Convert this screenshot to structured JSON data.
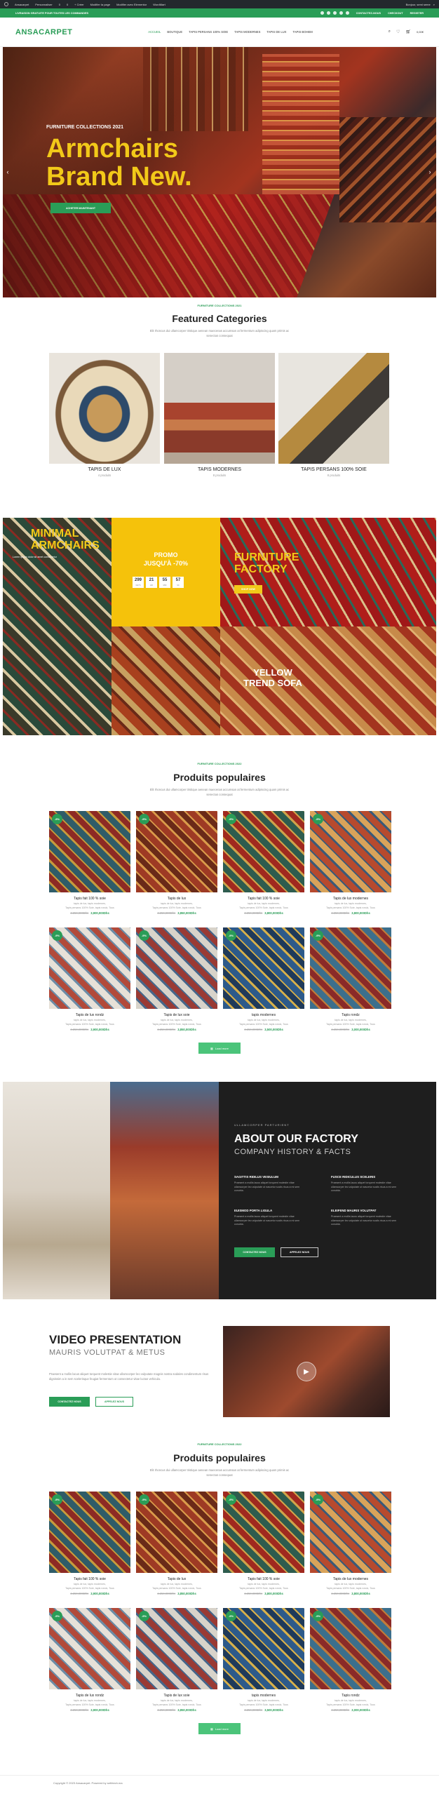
{
  "adminbar": {
    "items": [
      "Ansacarpet",
      "Personnaliser",
      "0",
      "0",
      "+ Créer",
      "Modifier la page",
      "Modifier avec Elementor",
      "WordMart"
    ],
    "right": "Bonjour, semi seme"
  },
  "topbar": {
    "text": "LIVRAISON GRATUITE POUR TOUTES LES COMMANDES",
    "links": [
      "CONTACTEZ-NOUS",
      "CHECKOUT",
      "REGISTER"
    ]
  },
  "header": {
    "logo": "ANSACARPET",
    "nav": [
      "ACCUEIL",
      "BOUTIQUE",
      "TAPIS PERSANS 100% SOIE",
      "TAPIS MODERNES",
      "TAPIS DE LUX",
      "TAPIS BOHEM"
    ],
    "cart": "0,00€"
  },
  "hero": {
    "subtitle": "FURNITURE COLLECTIONS 2021",
    "title_line1": "Armchairs",
    "title_line2": "Brand New.",
    "button": "ACHETER MAINTENANT"
  },
  "featured": {
    "kicker": "FURNITURE COLLECTIONS 2021",
    "title": "Featured Categories",
    "desc": "Elit rhoncus dui ullamcorper tristique aenean maecenas accumsan at fermentum adipiscing quam primis ac senectus consequat",
    "categories": [
      {
        "name": "TAPIS DE LUX",
        "count": "4 produits",
        "colors": [
          "#e9d9b9",
          "#2d4a6a",
          "#c79a5a"
        ]
      },
      {
        "name": "TAPIS MODERNES",
        "count": "8 produits",
        "colors": [
          "#d5cfc7",
          "#a8432e",
          "#6d7c8a"
        ]
      },
      {
        "name": "TAPIS PERSANS 100% SOIE",
        "count": "8 produits",
        "colors": [
          "#e8e5df",
          "#b58a3f",
          "#3e3a36"
        ]
      }
    ]
  },
  "promo": {
    "tile1": {
      "line1": "MINIMAL",
      "line2": "ARMCHAIRS",
      "sub": "Lorem ipsum dolor sit amet consectetur"
    },
    "tile2": {
      "line1": "PROMO",
      "line2": "JUSQU'À -70%",
      "countdown": [
        {
          "v": "299",
          "l": "DAYS"
        },
        {
          "v": "21",
          "l": "HR"
        },
        {
          "v": "55",
          "l": "MIN"
        },
        {
          "v": "57",
          "l": "SC"
        }
      ]
    },
    "tile3": {
      "line1": "FURNITURE",
      "line2": "FACTORY",
      "button": "SHOP NOW"
    },
    "tile4": {
      "line1": "YELLOW",
      "line2": "TREND SOFA"
    }
  },
  "popular1": {
    "kicker": "FURNITURE COLLECTIONS 2022",
    "title": "Produits populaires",
    "desc": "Elit rhoncus dui ullamcorper tristique aenean maecenas accumsan at fermentum adipiscing quam primis ac senectus consequat",
    "load": "Load more"
  },
  "popular2": {
    "kicker": "FURNITURE COLLECTIONS 2022",
    "title": "Produits populaires",
    "desc": "Elit rhoncus dui ullamcorper tristique aenean maecenas accumsan at fermentum adipiscing quam primis ac senectus consequat",
    "load": "Load more"
  },
  "products": [
    {
      "name": "Tapis fait 100 % soie",
      "badge": "-9%",
      "d1": "tapis de lux, tapis modernes,",
      "d2": "Tapis persans 100% Soie, tapis rondz, Tous",
      "old": "4.250,000Dhs",
      "price": "3,900,000Dhs",
      "c": [
        "#2f5c68",
        "#c79b3c",
        "#8d2a24"
      ]
    },
    {
      "name": "Tapis de lux",
      "badge": "-9%",
      "d1": "tapis de lux, tapis modernes,",
      "d2": "Tapis persans 100% Soie, tapis rondz, Tous",
      "old": "4.250,000Dhs",
      "price": "3,850,000Dhs",
      "c": [
        "#9e3a24",
        "#d99a4a",
        "#6a2a18"
      ]
    },
    {
      "name": "Tapis fait 100 % soie",
      "badge": "-9%",
      "d1": "tapis de lux, tapis modernes,",
      "d2": "Tapis persans 100% Soie, tapis rondz, Tous",
      "old": "4.250,000Dhs",
      "price": "3,800,000Dhs",
      "c": [
        "#2e5c4e",
        "#cfa24a",
        "#a0291f"
      ]
    },
    {
      "name": "Tapis de lux modernes",
      "badge": "-9%",
      "d1": "tapis de lux, tapis modernes,",
      "d2": "Tapis persans 100% Soie, tapis rondz, Tous",
      "old": "4.250,000Dhs",
      "price": "3,800,000Dhs",
      "c": [
        "#b74a2e",
        "#3a5a78",
        "#d9a35a"
      ]
    },
    {
      "name": "Tapis de lux rondz",
      "badge": "-9%",
      "d1": "tapis de lux, tapis modernes,",
      "d2": "Tapis persans 100% Soie, tapis rondz, Tous",
      "old": "4.250,000Dhs",
      "price": "3,900,000Dhs",
      "c": [
        "#e7e1d8",
        "#6c8ca6",
        "#b24a3a"
      ]
    },
    {
      "name": "Tapis de lux soie",
      "badge": "-9%",
      "d1": "tapis de lux, tapis modernes,",
      "d2": "Tapis persans 100% Soie, tapis rondz, Tous",
      "old": "4.250,000Dhs",
      "price": "3,850,000Dhs",
      "c": [
        "#d8d3ca",
        "#46668a",
        "#9a3a34"
      ]
    },
    {
      "name": "tapis modernes",
      "badge": "-9%",
      "d1": "tapis de lux, tapis modernes,",
      "d2": "Tapis persans 100% Soie, tapis rondz, Tous",
      "old": "4.250,000Dhs",
      "price": "3,500,000Dhs",
      "c": [
        "#2d5a8a",
        "#d7b04a",
        "#1f3a5a"
      ]
    },
    {
      "name": "Tapis rondz",
      "badge": "-9%",
      "d1": "tapis de lux, tapis modernes,",
      "d2": "Tapis persans 100% Soie, tapis rondz, Tous",
      "old": "4.250,000Dhs",
      "price": "3,000,000Dhs",
      "c": [
        "#3c6f8c",
        "#c07a3a",
        "#8a2a28"
      ]
    }
  ],
  "factory": {
    "small": "ULLAMCORPER PARTURIENT",
    "title": "ABOUT OUR FACTORY",
    "subtitle": "COMPANY HISTORY & FACTS",
    "features": [
      {
        "t": "SAGITTIS RIDILUS VESIULUM",
        "d": "Praesent a mollis lacus aliquet torquent molestie vitae ullamcorper leo vulputate ut nascetur sociis risus a mi sem conubia."
      },
      {
        "t": "FUSCE RIDICULUS SCELERIS",
        "d": "Praesent a mollis lacus aliquet torquent molestie vitae ullamcorper leo vulputate ut nascetur sociis risus a mi sem conubia."
      },
      {
        "t": "EUISMOD PORTA LIGULA",
        "d": "Praesent a mollis lacus aliquet torquent molestie vitae ullamcorper leo vulputate ut nascetur sociis risus a mi sem conubia."
      },
      {
        "t": "ELEIFEND MAURIS VOLUTPAT",
        "d": "Praesent a mollis lacus aliquet torquent molestie vitae ullamcorper leo vulputate ut nascetur sociis risus a mi sem conubia."
      }
    ],
    "btn1": "CONTACTEZ NOUS",
    "btn2": "APPELEZ NOUS"
  },
  "video": {
    "title": "VIDEO PRESENTATION",
    "subtitle": "MAURIS VOLUTPAT & METUS",
    "desc": "Praesent a mollis lacus aliquet torquent molestie vitae ullamcorper leo vulputate magnis nostra sodales condimentum risus dignissim a in sem scelerisque feugiat fermentum ut consectetur vitae luctus vehicula.",
    "btn1": "CONTACTEZ NOUS",
    "btn2": "APPELEZ NOUS"
  },
  "footer": {
    "text": "Copyright © 2023 Ansacarpet. Powered by sethtech.ma"
  },
  "colors": {
    "accent": "#2a9d57",
    "yellow": "#f2c919",
    "dark": "#1e1e1e"
  }
}
